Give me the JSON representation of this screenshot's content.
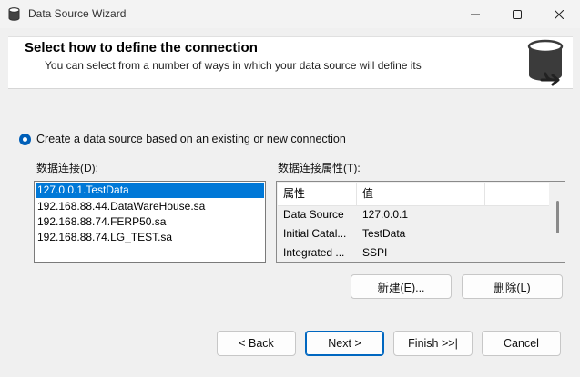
{
  "window": {
    "title": "Data Source Wizard",
    "minimize_glyph": "—",
    "maximize_glyph": "☐",
    "close_glyph": "✕"
  },
  "header": {
    "title": "Select how to define the connection",
    "subtitle": "You can select from a number of ways in which your data source will define its",
    "icon": "database-icon"
  },
  "option": {
    "label": "Create a data source based on an existing or new connection",
    "selected": true
  },
  "connections": {
    "label": "数据连接(D):",
    "items": [
      "127.0.0.1.TestData",
      "192.168.88.44.DataWareHouse.sa",
      "192.168.88.74.FERP50.sa",
      "192.168.88.74.LG_TEST.sa"
    ],
    "selected_index": 0
  },
  "properties": {
    "label": "数据连接属性(T):",
    "columns": [
      "属性",
      "值"
    ],
    "rows": [
      {
        "key": "Data Source",
        "value": "127.0.0.1"
      },
      {
        "key": "Initial Catal...",
        "value": "TestData"
      },
      {
        "key": "Integrated ...",
        "value": "SSPI"
      }
    ]
  },
  "buttons": {
    "new": "新建(E)...",
    "delete": "删除(L)",
    "back": "< Back",
    "next": "Next >",
    "finish": "Finish >>|",
    "cancel": "Cancel"
  },
  "colors": {
    "accent": "#0078d7",
    "default_button_border": "#0067c0"
  }
}
